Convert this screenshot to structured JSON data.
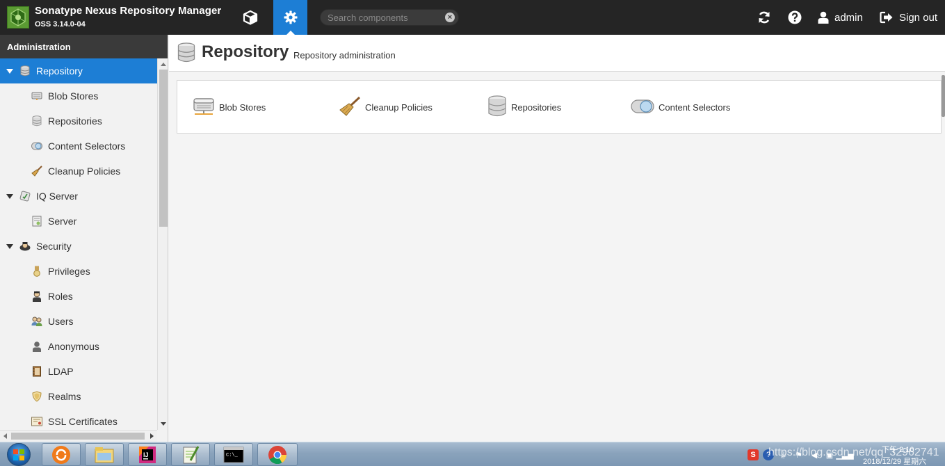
{
  "header": {
    "app_title": "Sonatype Nexus Repository Manager",
    "version": "OSS 3.14.0-04",
    "search_placeholder": "Search components",
    "user_label": "admin",
    "signout_label": "Sign out"
  },
  "sidebar": {
    "title": "Administration",
    "items": [
      {
        "label": "Repository",
        "level": 1,
        "expanded": true,
        "selected": true,
        "icon": "database-icon"
      },
      {
        "label": "Blob Stores",
        "level": 2,
        "icon": "blob-store-icon"
      },
      {
        "label": "Repositories",
        "level": 2,
        "icon": "database-icon"
      },
      {
        "label": "Content Selectors",
        "level": 2,
        "icon": "content-selector-icon"
      },
      {
        "label": "Cleanup Policies",
        "level": 2,
        "icon": "broom-icon"
      },
      {
        "label": "IQ Server",
        "level": 1,
        "expanded": true,
        "icon": "iq-server-icon"
      },
      {
        "label": "Server",
        "level": 2,
        "icon": "server-doc-icon"
      },
      {
        "label": "Security",
        "level": 1,
        "expanded": true,
        "icon": "security-badge-icon"
      },
      {
        "label": "Privileges",
        "level": 2,
        "icon": "medal-icon"
      },
      {
        "label": "Roles",
        "level": 2,
        "icon": "role-icon"
      },
      {
        "label": "Users",
        "level": 2,
        "icon": "users-icon"
      },
      {
        "label": "Anonymous",
        "level": 2,
        "icon": "person-icon"
      },
      {
        "label": "LDAP",
        "level": 2,
        "icon": "address-book-icon"
      },
      {
        "label": "Realms",
        "level": 2,
        "icon": "shield-icon"
      },
      {
        "label": "SSL Certificates",
        "level": 2,
        "icon": "certificate-icon"
      }
    ]
  },
  "page": {
    "title": "Repository",
    "subtitle": "Repository administration",
    "features": [
      {
        "label": "Blob Stores",
        "icon": "blob-store-icon"
      },
      {
        "label": "Cleanup Policies",
        "icon": "broom-icon"
      },
      {
        "label": "Repositories",
        "icon": "database-icon"
      },
      {
        "label": "Content Selectors",
        "icon": "content-selector-icon"
      }
    ]
  },
  "taskbar": {
    "time": "下午 2:10",
    "date": "2018/12/29 星期六",
    "watermark": "https://blog.csdn.net/qq_32962741"
  },
  "colors": {
    "header_bg": "#252525",
    "accent": "#1d7ed5",
    "sidebar_bg": "#f2f2f2",
    "sidebar_head": "#3a3a3a"
  }
}
